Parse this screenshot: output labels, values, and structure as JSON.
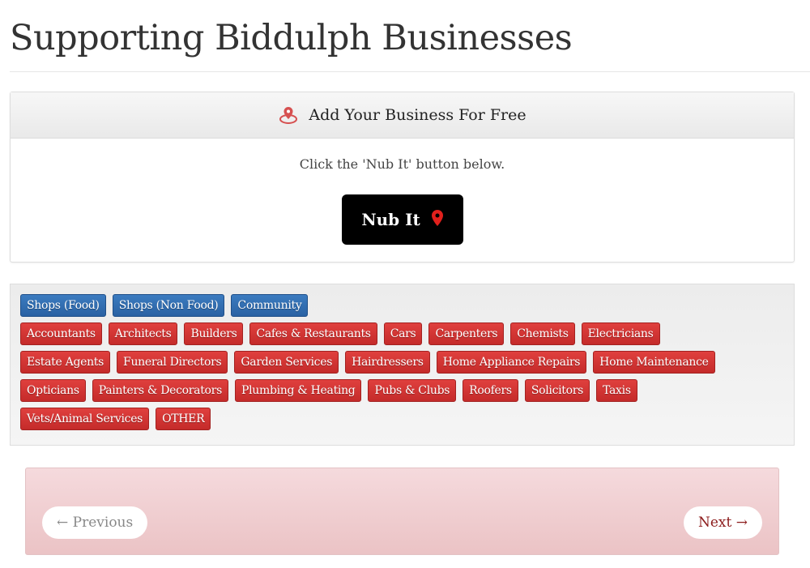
{
  "page": {
    "title": "Supporting Biddulph Businesses"
  },
  "add_business": {
    "heading": "Add Your Business For Free",
    "heading_icon": "map-pin-icon",
    "hint": "Click the 'Nub It' button below.",
    "button_label": "Nub It",
    "button_icon": "map-marker-icon",
    "accent_color": "#d62f2f"
  },
  "categories": {
    "primary": [
      "Shops (Food)",
      "Shops (Non Food)",
      "Community"
    ],
    "rows": [
      [
        "Accountants",
        "Architects",
        "Builders",
        "Cafes & Restaurants",
        "Cars",
        "Carpenters",
        "Chemists",
        "Electricians"
      ],
      [
        "Estate Agents",
        "Funeral Directors",
        "Garden Services",
        "Hairdressers",
        "Home Appliance Repairs",
        "Home Maintenance"
      ],
      [
        "Opticians",
        "Painters & Decorators",
        "Plumbing & Heating",
        "Pubs & Clubs",
        "Roofers",
        "Solicitors",
        "Taxis"
      ],
      [
        "Vets/Animal Services",
        "OTHER"
      ]
    ],
    "colors": {
      "primary": "#2f6aac",
      "secondary": "#d13634"
    }
  },
  "pager": {
    "previous": "← Previous",
    "next": "Next →"
  }
}
